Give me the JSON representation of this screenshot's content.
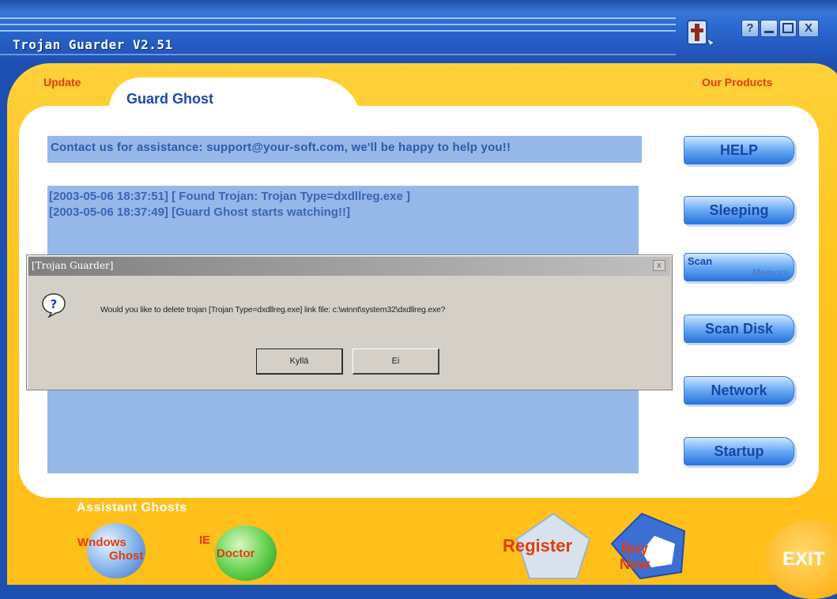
{
  "window": {
    "title": "Trojan Guarder V2.51"
  },
  "titlebar_buttons": {
    "help": "?",
    "close": "X"
  },
  "links": {
    "update": "Update",
    "products": "Our Products"
  },
  "panel": {
    "tab_label": "Guard Ghost",
    "contact": "Contact us for assistance: support@your-soft.com, we'll be happy to help you!!",
    "log": [
      "[2003-05-06 18:37:51] [ Found Trojan: Trojan Type=dxdllreg.exe ]",
      "[2003-05-06 18:37:49] [Guard Ghost starts watching!!]"
    ]
  },
  "side_buttons": {
    "help": "HELP",
    "sleeping": "Sleeping",
    "scan_memory_1": "Scan",
    "scan_memory_2": "Memory",
    "scan_disk": "Scan Disk",
    "network": "Network",
    "startup": "Startup"
  },
  "dialog": {
    "title": "[Trojan Guarder]",
    "close": "x",
    "message": "Would you like to delete trojan [Trojan Type=dxdllreg.exe] link file: c:\\winnt\\system32\\dxdllreg.exe?",
    "yes": "Kyllä",
    "no": "Ei"
  },
  "bottom": {
    "assistant_label": "Assistant Ghosts",
    "windows_ghost_1": "Wndows",
    "windows_ghost_2": "Ghost",
    "ie_doctor_1": "IE",
    "ie_doctor_2": "Doctor",
    "register": "Register",
    "buy_1": "Buy",
    "buy_2": "Now",
    "exit": "EXIT"
  },
  "colors": {
    "title_blue": "#2a66cf",
    "frame_yellow": "#ffc420",
    "panel_blue": "#95b8e8",
    "accent_red": "#e23c0c"
  }
}
